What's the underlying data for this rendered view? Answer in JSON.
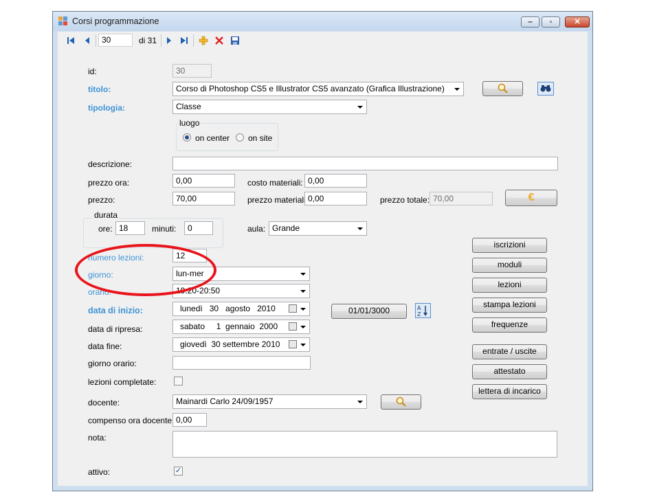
{
  "window": {
    "title": "Corsi programmazione"
  },
  "toolbar": {
    "position": "30",
    "of_total": "di 31"
  },
  "form": {
    "id": {
      "label": "id:",
      "value": "30"
    },
    "titolo": {
      "label": "titolo:",
      "value": "Corso di Photoshop CS5 e Illustrator CS5 avanzato (Grafica Illustrazione)"
    },
    "tipologia": {
      "label": "tipologia:",
      "value": "Classe"
    },
    "luogo": {
      "title": "luogo",
      "option1": "on center",
      "option2": "on site",
      "selected": "on center"
    },
    "descrizione": {
      "label": "descrizione:",
      "value": ""
    },
    "prezzo_ora": {
      "label": "prezzo ora:",
      "value": "0,00"
    },
    "costo_materiali": {
      "label": "costo materiali:",
      "value": "0,00"
    },
    "prezzo": {
      "label": "prezzo:",
      "value": "70,00"
    },
    "prezzo_materiali": {
      "label": "prezzo materiali:",
      "value": "0,00"
    },
    "prezzo_totale": {
      "label": "prezzo totale:",
      "value": "70,00"
    },
    "durata": {
      "title": "durata",
      "ore_label": "ore:",
      "ore": "18",
      "minuti_label": "minuti:",
      "minuti": "0"
    },
    "aula": {
      "label": "aula:",
      "value": "Grande"
    },
    "numero_lezioni": {
      "label": "numero lezioni:",
      "value": "12"
    },
    "giorno": {
      "label": "giorno:",
      "value": "lun-mer"
    },
    "orario": {
      "label": "orario:",
      "value": "19:20-20:50"
    },
    "data_inizio": {
      "label": "data di inizio:",
      "value": "lunedì   30   agosto   2010"
    },
    "data_ripresa": {
      "label": "data di ripresa:",
      "value": "sabato     1  gennaio  2000"
    },
    "data_fine": {
      "label": "data fine:",
      "value": "giovedì  30 settembre 2010"
    },
    "giorno_orario": {
      "label": "giorno orario:",
      "value": ""
    },
    "lezioni_completate": {
      "label": "lezioni completate:",
      "checked": false
    },
    "docente": {
      "label": "docente:",
      "value": "Mainardi Carlo 24/09/1957"
    },
    "compenso": {
      "label": "compenso ora docente:",
      "value": "0,00"
    },
    "nota": {
      "label": "nota:",
      "value": ""
    },
    "attivo": {
      "label": "attivo:",
      "checked": true
    },
    "date_button": "01/01/3000",
    "euro_symbol": "€"
  },
  "side_buttons": [
    "iscrizioni",
    "moduli",
    "lezioni",
    "stampa lezioni",
    "frequenze",
    "entrate / uscite",
    "attestato",
    "lettera di incarico"
  ],
  "colors": {
    "label_blue": "#3d93d6",
    "annotation_red": "#e8141b"
  }
}
